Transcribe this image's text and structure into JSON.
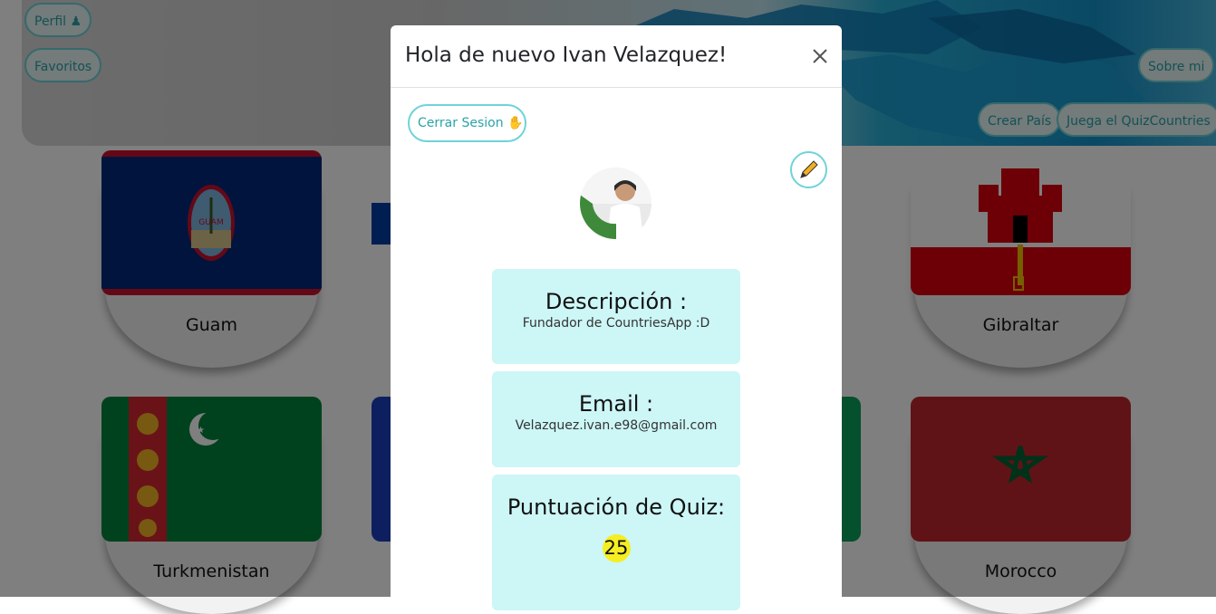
{
  "nav": {
    "profile_label": "Perfil",
    "profile_icon": "bust-icon",
    "favorites_label": "Favoritos",
    "about_label": "Sobre mi",
    "create_country_label": "Crear País",
    "quiz_label": "Juega el QuizCountries"
  },
  "cards": [
    {
      "name": "Guam"
    },
    {
      "name": "Gibraltar"
    },
    {
      "name": "Turkmenistan"
    },
    {
      "name": "Morocco"
    }
  ],
  "modal": {
    "title": "Hola de nuevo Ivan Velazquez!",
    "close_icon": "close-icon",
    "logout_label": "Cerrar Sesion",
    "logout_icon": "waving-hand-icon",
    "edit_icon": "pencil-icon",
    "description_title": "Descripción :",
    "description_value": "Fundador de CountriesApp :D",
    "email_title": "Email :",
    "email_value": "Velazquez.ivan.e98@gmail.com",
    "quiz_title": "Puntuación de Quiz:",
    "quiz_score": "25"
  },
  "colors": {
    "accent": "#6fd3d8",
    "accent_text": "#2aa3a8",
    "info_box": "#cdf6f6",
    "score_badge": "#f5ee22"
  }
}
